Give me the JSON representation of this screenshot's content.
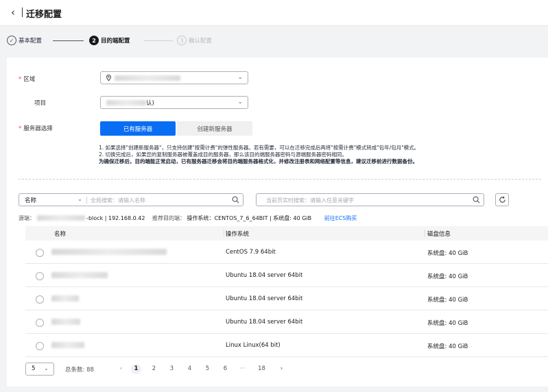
{
  "header": {
    "back_icon": "chevron-left-icon",
    "title": "迁移配置"
  },
  "steps": [
    {
      "num": "✓",
      "label": "基本配置",
      "state": "done"
    },
    {
      "num": "2",
      "label": "目的端配置",
      "state": "active"
    },
    {
      "num": "3",
      "label": "确认配置",
      "state": "todo"
    }
  ],
  "form": {
    "region_label": "区域",
    "project_label": "项目",
    "project_value_suffix": "认)",
    "server_label": "服务器选择",
    "btn_existing": "已有服务器",
    "btn_new": "创建新服务器",
    "note1": "1. 如果选择\"创建新服务器\"，只支持创建\"按需计费\"的弹性服务器。若有需要，可以在迁移完成后再将\"按需计费\"模式转成\"包年/包月\"模式。",
    "note2": "2. 切换完成后，如果您的复制服务器被覆盖成目的服务器，那么该目的端服务器密码与源端服务器密码相同。",
    "note3": "为确保迁移后，目的端能正常启动，已有服务器迁移会将目的端服务器格式化，并修改注册表和网络配置等信息，建议迁移前进行数据备份。"
  },
  "filter": {
    "select_value": "名称",
    "global_placeholder": "全局搜索：请输入名称",
    "page_placeholder": "当前页实时搜索：请输入任意关键字"
  },
  "info": {
    "source_label": "源端：",
    "source_value": "-block | 192.168.0.42",
    "recommend_label": "推荐目的端：",
    "os_label": "操作系统：",
    "os_value": "CENTOS_7_6_64BIT | 系统盘: 40 GiB",
    "link": "前往ECS购买"
  },
  "table": {
    "columns": [
      "名称",
      "操作系统",
      "磁盘信息"
    ],
    "rows": [
      {
        "os": "CentOS 7.9 64bit",
        "disk": "系统盘: 40 GiB"
      },
      {
        "os": "Ubuntu 18.04 server 64bit",
        "disk": "系统盘: 40 GiB"
      },
      {
        "os": "Ubuntu 18.04 server 64bit",
        "disk": "系统盘: 40 GiB"
      },
      {
        "os": "Ubuntu 18.04 server 64bit",
        "disk": "系统盘: 40 GiB"
      },
      {
        "os": "Linux Linux(64 bit)",
        "disk": "系统盘: 40 GiB"
      }
    ]
  },
  "pager": {
    "page_size": "5",
    "total": "总条数: 88",
    "prev": "‹",
    "pages": [
      "1",
      "2",
      "3",
      "4",
      "5",
      "6"
    ],
    "ellipsis": "···",
    "last": "18",
    "next": "›",
    "current": "1"
  },
  "colors": {
    "primary": "#0a6ef5",
    "required": "#e84d3d"
  }
}
